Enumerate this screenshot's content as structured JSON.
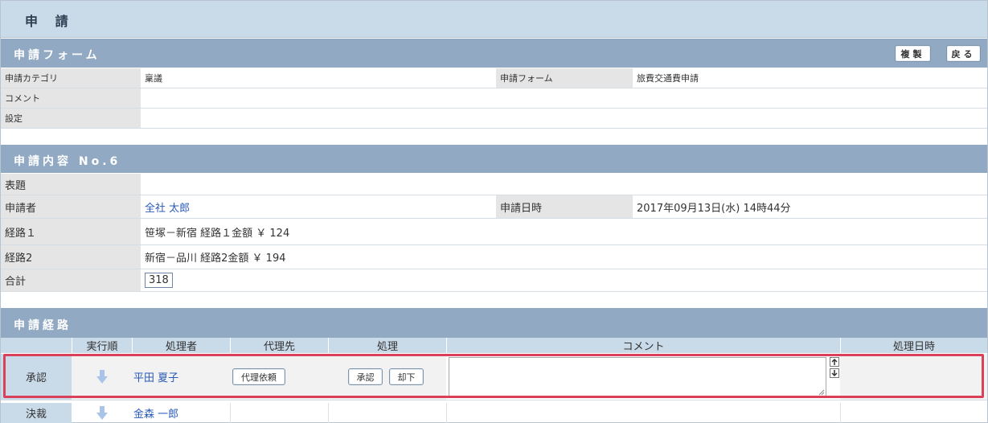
{
  "page": {
    "title": "申 請"
  },
  "form_section": {
    "header": "申請フォーム",
    "copy_button": "複製",
    "back_button": "戻る",
    "rows": {
      "category_label": "申請カテゴリ",
      "category_value": "稟議",
      "form_label": "申請フォーム",
      "form_value": "旅費交通費申請",
      "comment_label": "コメント",
      "settings_label": "設定"
    }
  },
  "content_section": {
    "header": "申請内容 No.6",
    "subject_label": "表題",
    "applicant_label": "申請者",
    "applicant_value": "全社 太郎",
    "datetime_label": "申請日時",
    "datetime_value": "2017年09月13日(水) 14時44分",
    "route1_label": "経路１",
    "route1_value": "笹塚－新宿 経路１金額 ￥ 124",
    "route2_label": "経路2",
    "route2_value": "新宿－品川 経路2金額 ￥ 194",
    "total_label": "合計",
    "total_value": "318"
  },
  "route_section": {
    "header": "申請経路",
    "columns": [
      "実行順",
      "処理者",
      "代理先",
      "処理",
      "コメント",
      "処理日時"
    ],
    "steps": [
      {
        "type": "承認",
        "processor": "平田 夏子",
        "delegate_button": "代理依頼",
        "approve_button": "承認",
        "reject_button": "却下",
        "comment": ""
      },
      {
        "type": "決裁",
        "processor": "金森 一郎"
      }
    ]
  },
  "colors": {
    "section_header": "#91a9c3",
    "title_bar": "#c9dae9",
    "link": "#2a5bb8",
    "highlight": "#d9415a",
    "arrow": "#a9c4e8"
  },
  "icons": [
    "arrow-down-icon",
    "scroll-up-icon",
    "scroll-down-icon",
    "resize-grip-icon"
  ]
}
